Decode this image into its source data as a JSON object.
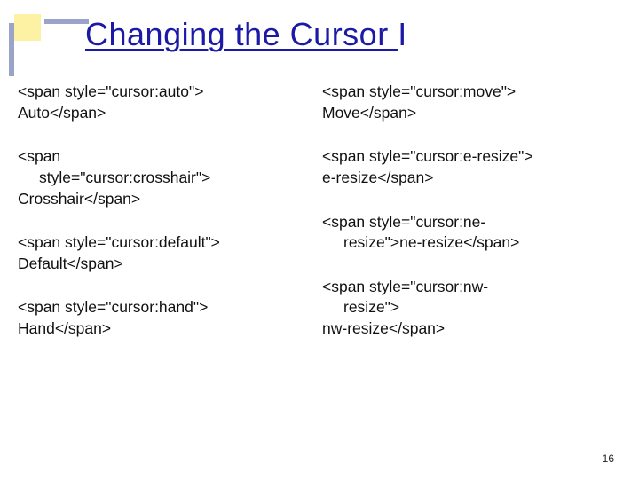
{
  "title": {
    "underlined": "Changing the Cursor ",
    "suffix": "I"
  },
  "left": {
    "s1": {
      "l1": "<span style=\"cursor:auto\">",
      "l2": "Auto</span>"
    },
    "s2": {
      "l1": "<span",
      "l2": "style=\"cursor:crosshair\">",
      "l3": "Crosshair</span>"
    },
    "s3": {
      "l1": "<span style=\"cursor:default\">",
      "l2": "Default</span>"
    },
    "s4": {
      "l1": "<span style=\"cursor:hand\">",
      "l2": "Hand</span>"
    }
  },
  "right": {
    "s1": {
      "l1": "<span style=\"cursor:move\">",
      "l2": "Move</span>"
    },
    "s2": {
      "l1": "<span style=\"cursor:e-resize\">",
      "l2": "e-resize</span>"
    },
    "s3": {
      "l1": "<span style=\"cursor:ne-",
      "l2": "resize\">ne-resize</span>"
    },
    "s4": {
      "l1": "<span style=\"cursor:nw-",
      "l2": "resize\">",
      "l3": "nw-resize</span>"
    }
  },
  "page_number": "16"
}
